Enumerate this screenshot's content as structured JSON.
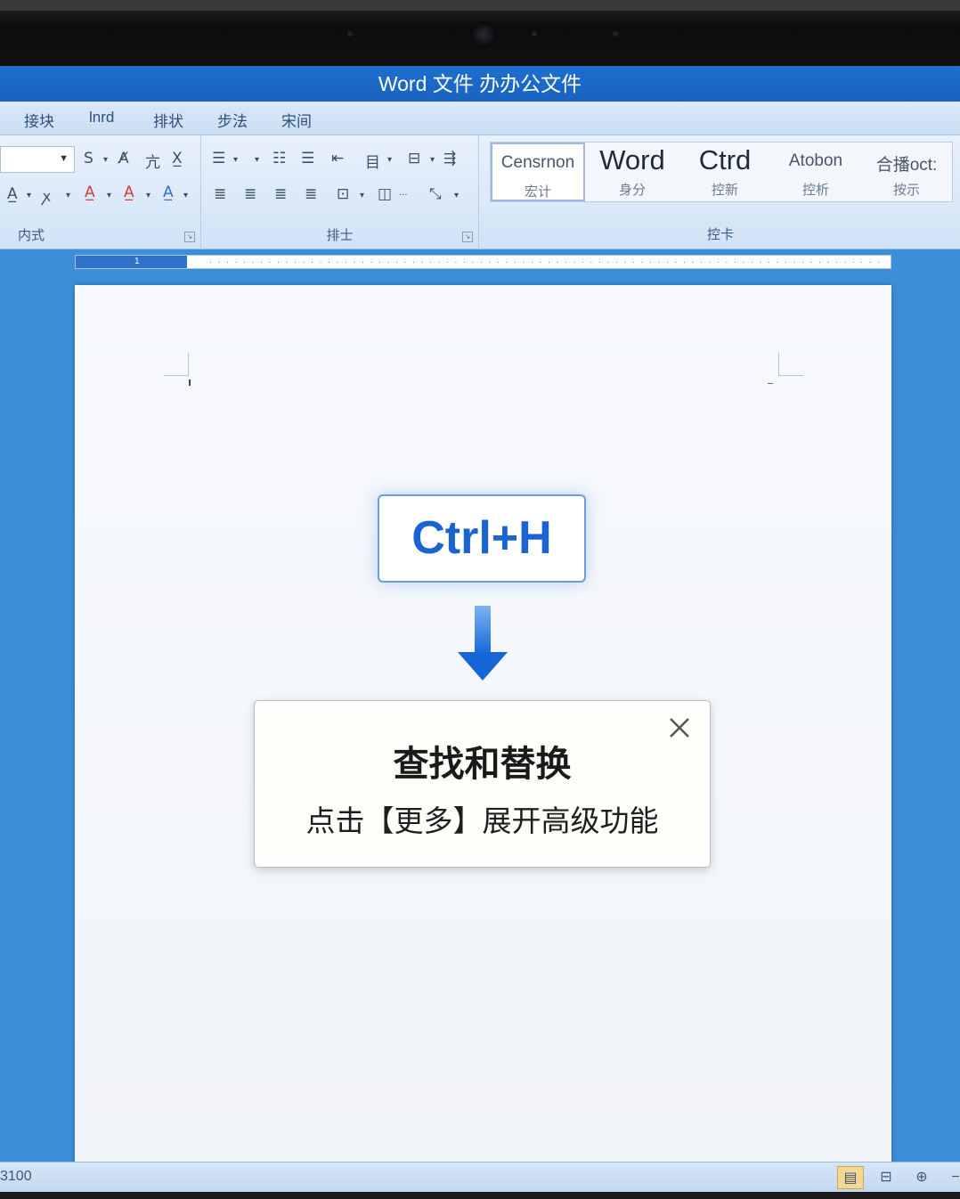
{
  "window": {
    "title": "Word 文件  办办公文件"
  },
  "tabs": [
    {
      "label": "接块"
    },
    {
      "label": "lnrd"
    },
    {
      "label": "排状"
    },
    {
      "label": "步法"
    },
    {
      "label": "宋间"
    }
  ],
  "ribbon": {
    "font_group_label": "内式",
    "paragraph_group_label": "排士",
    "styles_group_label": "控卡",
    "styles": [
      {
        "name": "Censrnon",
        "sub": "宏计"
      },
      {
        "name": "Word",
        "sub": "身分"
      },
      {
        "name": "Ctrd",
        "sub": "控新"
      },
      {
        "name": "Atobon",
        "sub": "控析"
      },
      {
        "name": "合播oct:",
        "sub": "按示"
      }
    ]
  },
  "ruler": {
    "active_number": "1"
  },
  "overlay": {
    "shortcut": "Ctrl+H",
    "dialog_title": "查找和替换",
    "dialog_subtitle": "点击【更多】展开高级功能"
  },
  "statusbar": {
    "text": "3100"
  },
  "colors": {
    "title_bar": "#1d6fcf",
    "accent": "#1a63d1",
    "arrow": "#1f72e0"
  },
  "icons": {
    "close": "close-icon",
    "arrow": "arrow-down-icon"
  }
}
